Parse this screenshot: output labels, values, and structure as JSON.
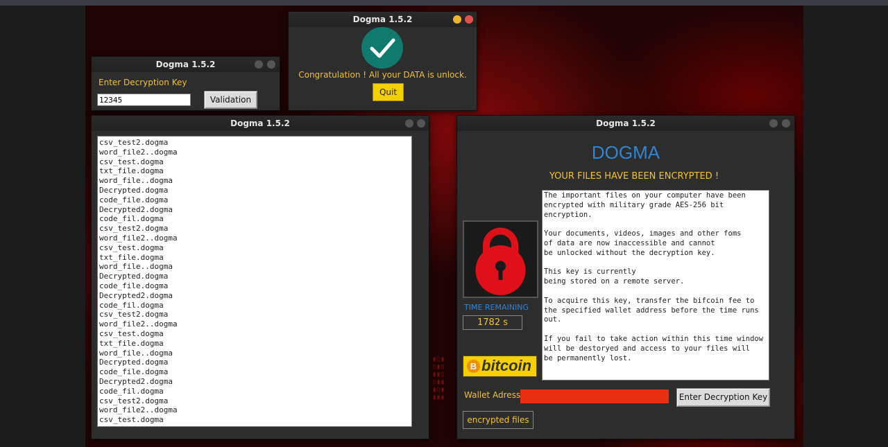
{
  "colors": {
    "accent_yellow": "#f2c230",
    "dogma_blue": "#2e86d4",
    "lock_red": "#e0101a",
    "wallet_red": "#e8300f",
    "success_teal": "#107a6e"
  },
  "key_window": {
    "title": "Dogma 1.5.2",
    "prompt": "Enter Decryption Key",
    "key_value": "12345",
    "validate_label": "Validation"
  },
  "unlock_window": {
    "title": "Dogma 1.5.2",
    "icon": "checkmark-icon",
    "message": "Congratulation ! All your DATA is unlock.",
    "quit_label": "Quit"
  },
  "files_window": {
    "title": "Dogma 1.5.2",
    "files": [
      "csv_test2.dogma",
      "word_file2..dogma",
      "csv_test.dogma",
      "txt_file.dogma",
      "word_file..dogma",
      "Decrypted.dogma",
      "code_file.dogma",
      "Decrypted2.dogma",
      "code_fil.dogma",
      "csv_test2.dogma",
      "word_file2..dogma",
      "csv_test.dogma",
      "txt_file.dogma",
      "word_file..dogma",
      "Decrypted.dogma",
      "code_file.dogma",
      "Decrypted2.dogma",
      "code_fil.dogma",
      "csv_test2.dogma",
      "word_file2..dogma",
      "csv_test.dogma",
      "txt_file.dogma",
      "word_file..dogma",
      "Decrypted.dogma",
      "code_file.dogma",
      "Decrypted2.dogma",
      "code_fil.dogma",
      "csv_test2.dogma",
      "word_file2..dogma",
      "csv_test.dogma"
    ]
  },
  "main_window": {
    "title": "Dogma 1.5.2",
    "heading": "DOGMA",
    "subheading": "YOUR FILES HAVE BEEN ENCRYPTED !",
    "message": "The important files on your computer have been\nencrypted with military grade AES-256 bit\nencryption.\n\nYour documents, videos, images and other foms\nof data are now inaccessible and cannot\nbe unlocked without the decryption key.\n\nThis key is currently\nbeing stored on a remote server.\n\nTo acquire this key, transfer the bifcoin fee to\nthe specified wallet address before the time runs\nout.\n\nIf you fail to take action within this time window\nwill be destoryed and access to your files will\nbe permanently lost.",
    "icon": "padlock-icon",
    "time_label": "TIME REMAINING",
    "time_value": "1782 s",
    "bitcoin_label": "bitcoin",
    "bitcoin_symbol": "B",
    "wallet_label": "Wallet Adress:",
    "wallet_value": "",
    "enter_key_label": "Enter Decryption Key",
    "encrypted_files_label": "encrypted files"
  }
}
